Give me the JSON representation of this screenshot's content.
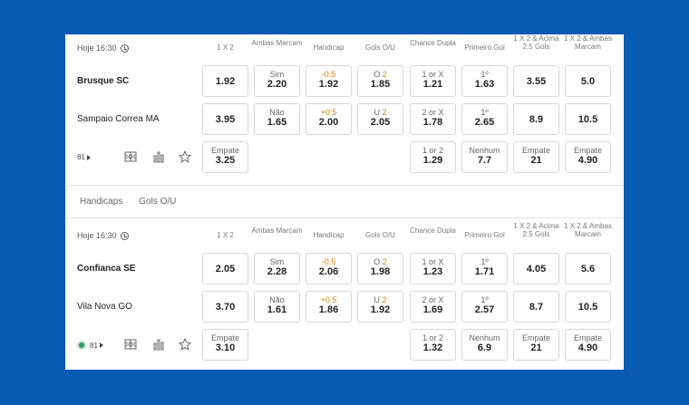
{
  "headers": [
    "1 X 2",
    "Ambas Marcam",
    "Handicap",
    "Gols O/U",
    "Chance Dupla",
    "Primeiro Gol",
    "1 X 2 & Acima 2.5 Gols",
    "1 X 2 & Ambas Marcam"
  ],
  "tabs": [
    "Handicaps",
    "Gols O/U"
  ],
  "icons": [
    "field-icon",
    "stats-icon",
    "star-icon"
  ],
  "events": [
    {
      "time": "Hoje 16:30",
      "home": "Brusque SC",
      "away": "Sampaio Correa MA",
      "markets": "81",
      "live": false,
      "row1": [
        {
          "l": "",
          "v": "1.92"
        },
        {
          "l": "Sim",
          "v": "2.20"
        },
        {
          "l": "-0.5",
          "v": "1.92",
          "hl": true
        },
        {
          "l": "O ",
          "l2": "2",
          "v": "1.85"
        },
        {
          "l": "1 or X",
          "v": "1.21"
        },
        {
          "l": "1º",
          "v": "1.63"
        },
        {
          "l": "",
          "v": "3.55"
        },
        {
          "l": "",
          "v": "5.0"
        }
      ],
      "row2": [
        {
          "l": "",
          "v": "3.95"
        },
        {
          "l": "Não",
          "v": "1.65"
        },
        {
          "l": "+0.5",
          "v": "2.00",
          "hl": true
        },
        {
          "l": "U ",
          "l2": "2",
          "v": "2.05"
        },
        {
          "l": "2 or X",
          "v": "1.78"
        },
        {
          "l": "1º",
          "v": "2.65"
        },
        {
          "l": "",
          "v": "8.9"
        },
        {
          "l": "",
          "v": "10.5"
        }
      ],
      "row3": [
        {
          "col": 0,
          "l": "Empate",
          "v": "3.25"
        },
        {
          "col": 4,
          "l": "1 or 2",
          "v": "1.29"
        },
        {
          "col": 5,
          "l": "Nenhum",
          "v": "7.7"
        },
        {
          "col": 6,
          "l": "Empate",
          "v": "21"
        },
        {
          "col": 7,
          "l": "Empate",
          "v": "4.90"
        }
      ]
    },
    {
      "time": "Hoje 16:30",
      "home": "Confianca SE",
      "away": "Vila Nova GO",
      "markets": "81",
      "live": true,
      "row1": [
        {
          "l": "",
          "v": "2.05"
        },
        {
          "l": "Sim",
          "v": "2.28"
        },
        {
          "l": "-0.5",
          "v": "2.06",
          "hl": true
        },
        {
          "l": "O ",
          "l2": "2",
          "v": "1.98"
        },
        {
          "l": "1 or X",
          "v": "1.23"
        },
        {
          "l": "1º",
          "v": "1.71"
        },
        {
          "l": "",
          "v": "4.05"
        },
        {
          "l": "",
          "v": "5.6"
        }
      ],
      "row2": [
        {
          "l": "",
          "v": "3.70"
        },
        {
          "l": "Não",
          "v": "1.61"
        },
        {
          "l": "+0.5",
          "v": "1.86",
          "hl": true
        },
        {
          "l": "U ",
          "l2": "2",
          "v": "1.92"
        },
        {
          "l": "2 or X",
          "v": "1.69"
        },
        {
          "l": "1º",
          "v": "2.57"
        },
        {
          "l": "",
          "v": "8.7"
        },
        {
          "l": "",
          "v": "10.5"
        }
      ],
      "row3": [
        {
          "col": 0,
          "l": "Empate",
          "v": "3.10"
        },
        {
          "col": 4,
          "l": "1 or 2",
          "v": "1.32"
        },
        {
          "col": 5,
          "l": "Nenhum",
          "v": "6.9"
        },
        {
          "col": 6,
          "l": "Empate",
          "v": "21"
        },
        {
          "col": 7,
          "l": "Empate",
          "v": "4.90"
        }
      ]
    }
  ],
  "colors": {
    "background": "#0a5bb4",
    "highlight": "#e08000",
    "live": "#2a9a5a"
  }
}
